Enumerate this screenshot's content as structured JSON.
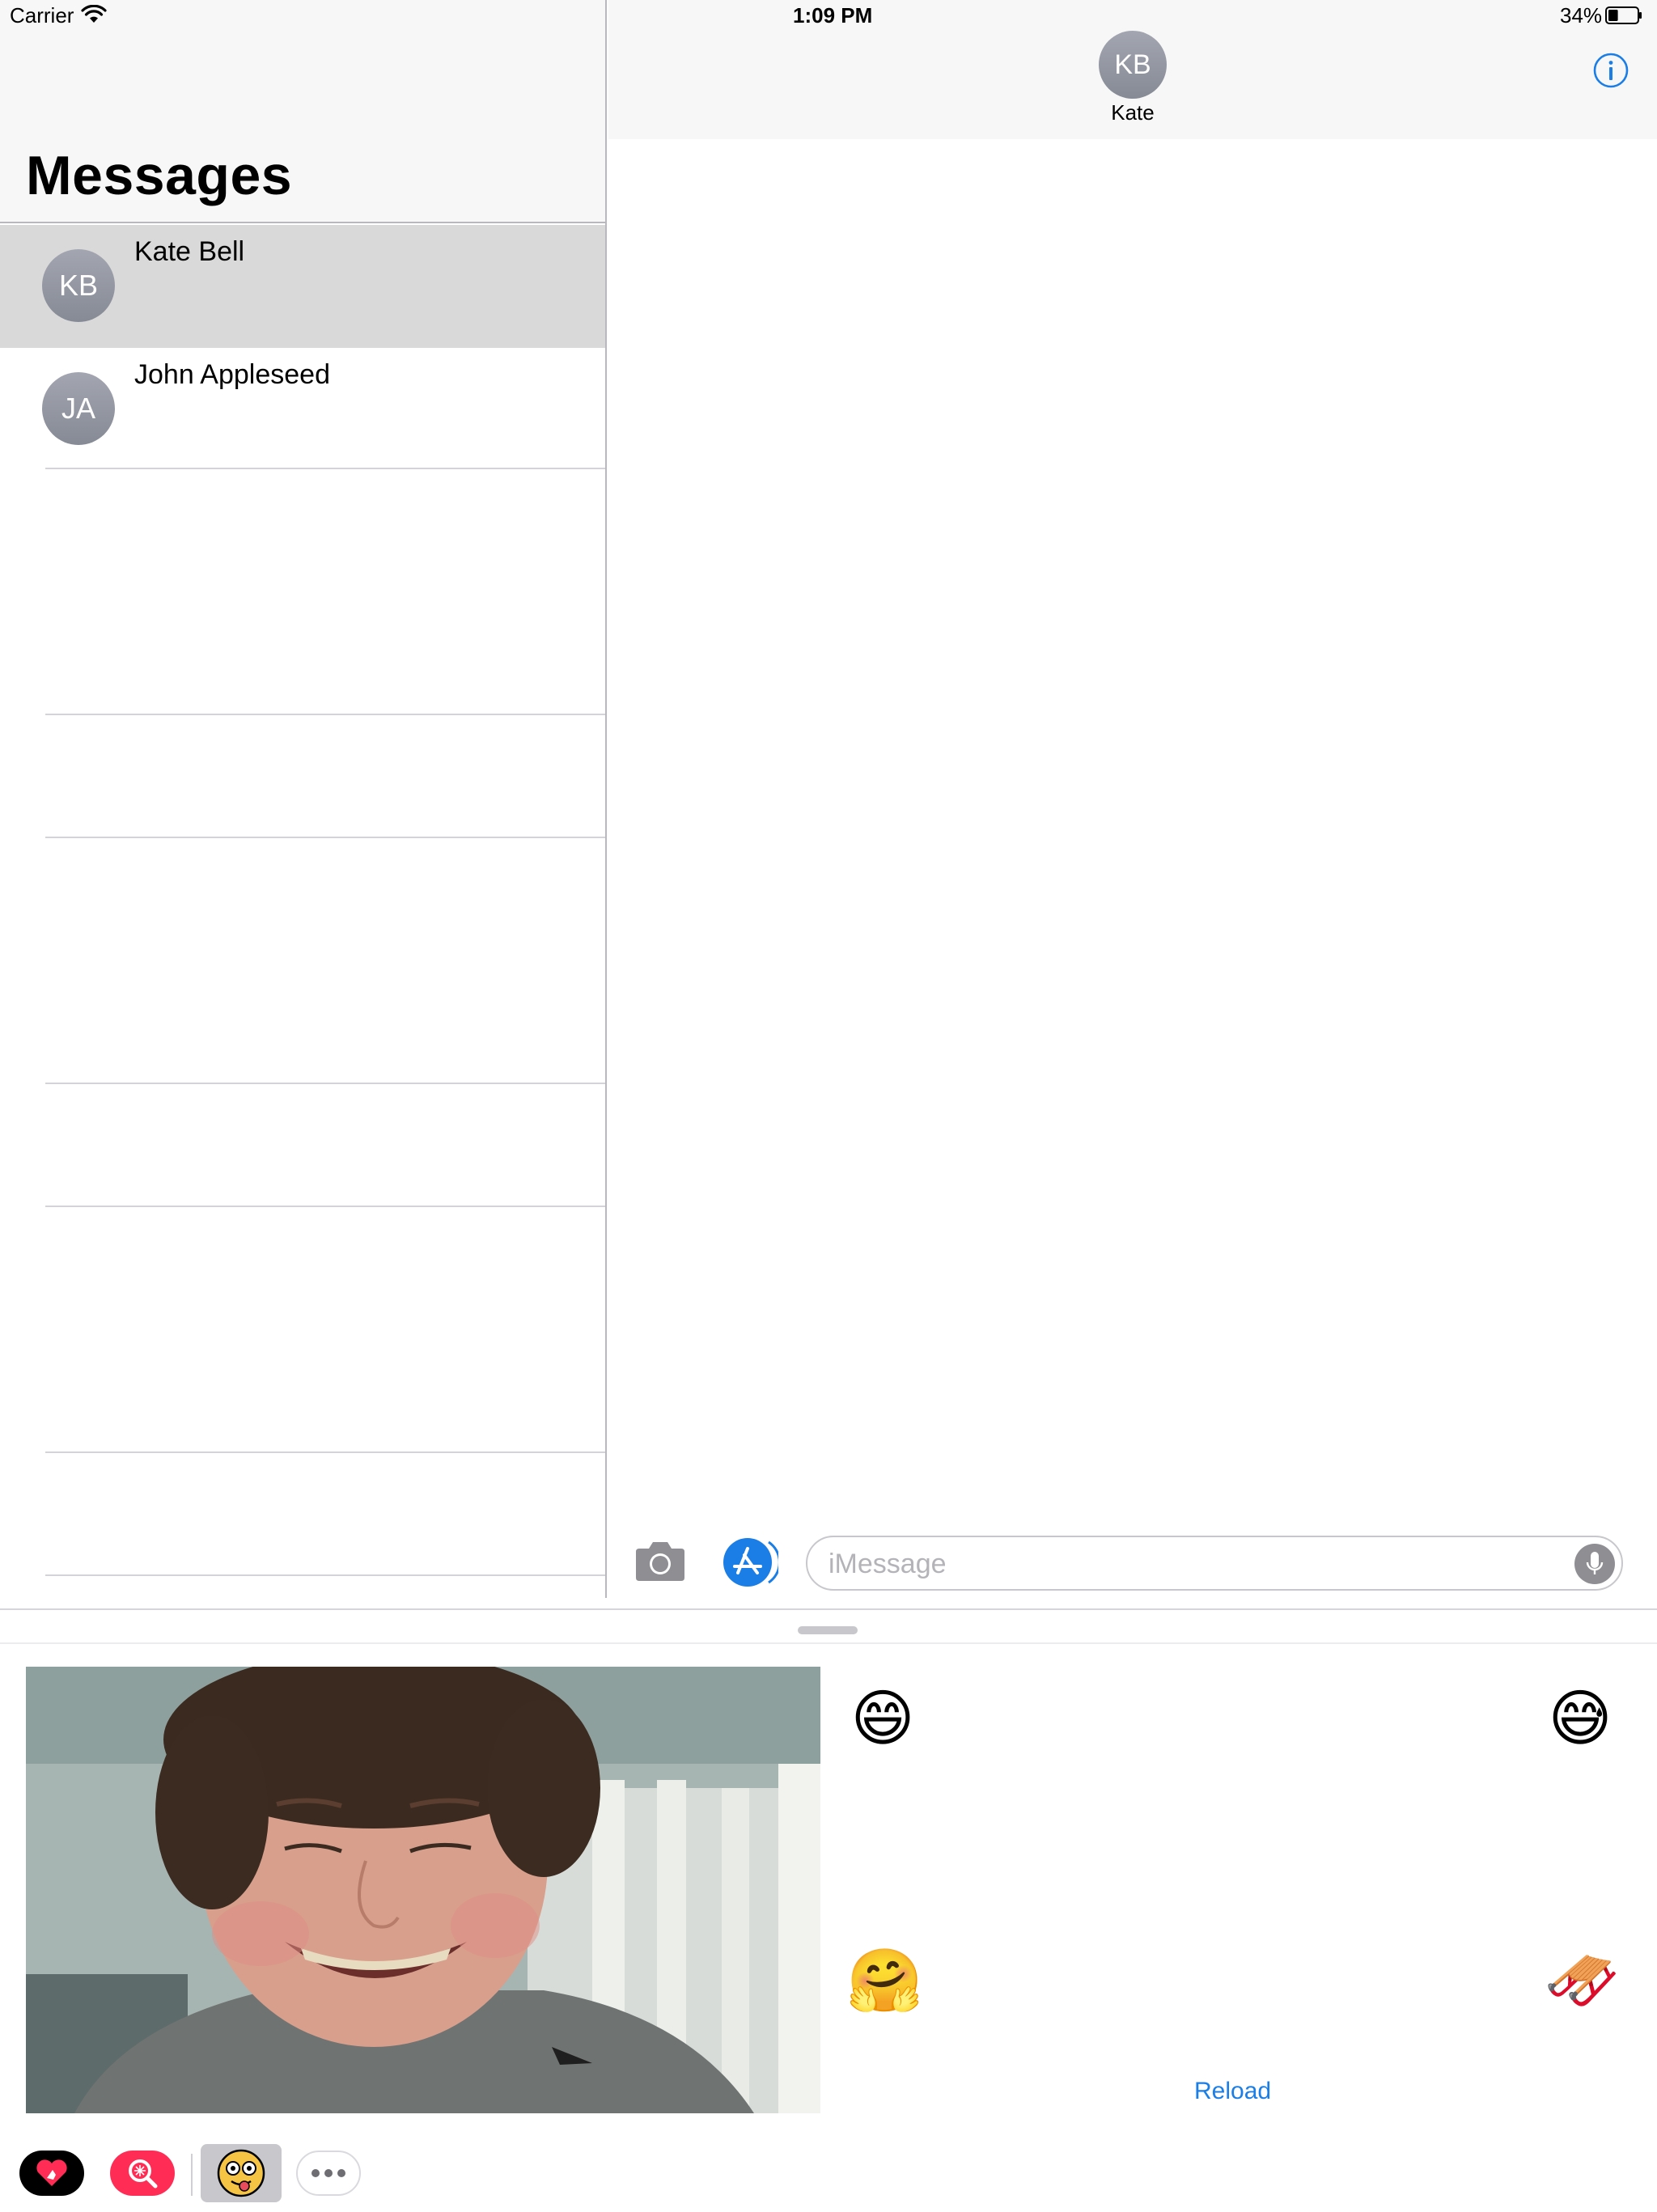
{
  "status_bar": {
    "carrier": "Carrier",
    "time": "1:09 PM",
    "battery": "34%",
    "battery_level": 0.34
  },
  "master": {
    "title": "Messages",
    "conversations": [
      {
        "initials": "KB",
        "name": "Kate Bell",
        "selected": true
      },
      {
        "initials": "JA",
        "name": "John Appleseed",
        "selected": false
      }
    ]
  },
  "detail": {
    "contact_initials": "KB",
    "contact_name": "Kate",
    "info_icon": "info-icon"
  },
  "input_bar": {
    "placeholder": "iMessage",
    "camera_icon": "camera-icon",
    "appstore_icon": "app-store-icon",
    "mic_icon": "microphone-icon"
  },
  "drawer": {
    "emojis": [
      "😄",
      "😅",
      "🤗",
      "🛷"
    ],
    "reload_label": "Reload",
    "tray": [
      "digital-touch-heart-icon",
      "images-search-icon",
      "emoji-app-icon",
      "more-icon"
    ]
  },
  "colors": {
    "accent": "#1a7ee6",
    "selected_row": "#d9d9d9",
    "header_bg": "#f7f7f7",
    "avatar": "#8e929c"
  }
}
